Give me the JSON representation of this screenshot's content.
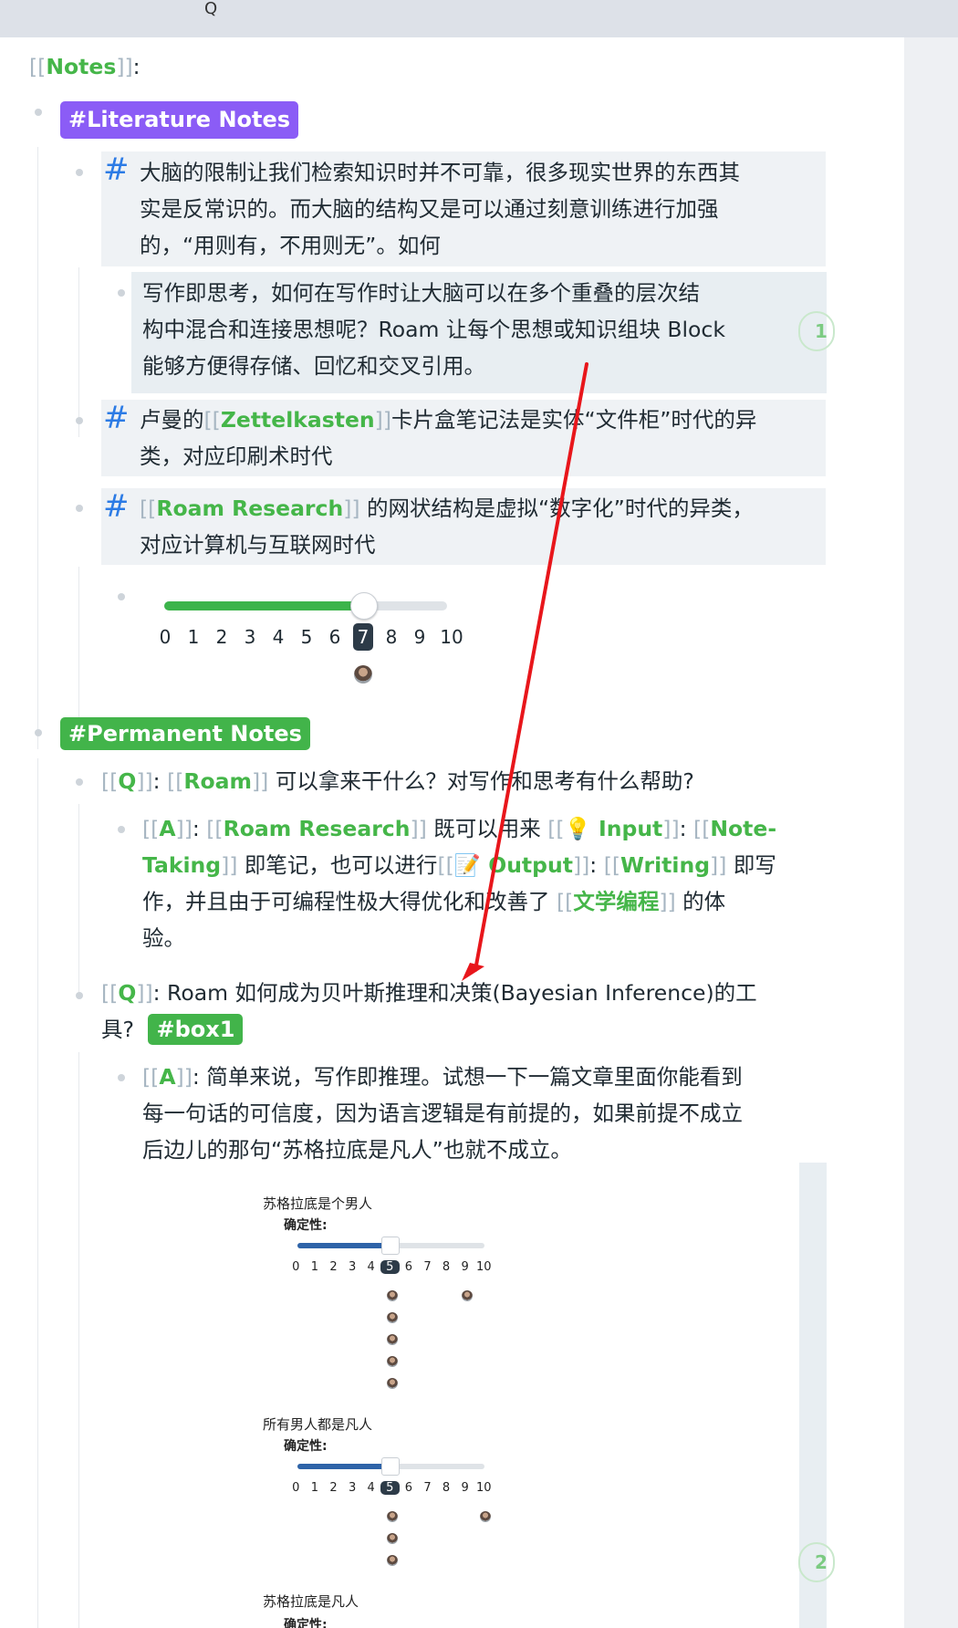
{
  "topbar": {
    "q_label": "Q"
  },
  "page": {
    "notes_bracket_open": "[[",
    "notes_title": "Notes",
    "notes_bracket_close": "]]",
    "notes_colon": ":"
  },
  "literature": {
    "tag": "#Literature Notes",
    "hash_glyph": "#",
    "block1": {
      "line1": "大脑的限制让我们检索知识时并不可靠，很多现实世界的东西其",
      "line2": "实是反常识的。而大脑的结构又是可以通过刻意训练进行加强",
      "line3": "的，“用则有，不用则无”。如何"
    },
    "child1": {
      "line1": "写作即思考，如何在写作时让大脑可以在多个重叠的层次结",
      "line2": "构中混合和连接思想呢？Roam 让每个思想或知识组块 Block",
      "line3": "能够方便得存储、回忆和交叉引用。",
      "badge": "1"
    },
    "block2": {
      "pre": "卢曼的",
      "link": "Zettelkasten",
      "post": "卡片盒笔记法是实体“文件柜”时代的异",
      "line2": "类，对应印刷术时代"
    },
    "block3": {
      "link": "Roam Research",
      "post": " 的网状结构是虚拟“数字化”时代的异类，",
      "line2": "对应计算机与互联网时代"
    },
    "slider": {
      "value": 7,
      "min": 0,
      "max": 10,
      "fill_color": "#3cb44b",
      "numbers": [
        "0",
        "1",
        "2",
        "3",
        "4",
        "5",
        "6",
        "7",
        "8",
        "9",
        "10"
      ]
    }
  },
  "permanent": {
    "tag": "#Permanent Notes",
    "q1": {
      "q": "Q",
      "roam": "Roam",
      "text": " 可以拿来干什么？对写作和思考有什么帮助?"
    },
    "a1": {
      "a": "A",
      "roam_research": "Roam Research",
      "t1": " 既可以用来 ",
      "input": "💡 Input",
      "note_a": "Note-",
      "note_b": "Taking",
      "t2": " 即笔记，也可以进行",
      "output": "📝 Output",
      "writing": "Writing",
      "t3": " 即写",
      "line3_pre": "作，并且由于可编程性极大得优化和改善了 ",
      "lit_prog": "文学编程",
      "line3_post": " 的体",
      "line4": "验。"
    },
    "q2": {
      "q": "Q",
      "text": ": Roam 如何成为贝叶斯推理和决策(Bayesian Inference)的工",
      "line2": "具?",
      "tag": "#box1"
    },
    "a2": {
      "a": "A",
      "line1": ": 简单来说，写作即推理。试想一下一篇文章里面你能看到",
      "line2": "每一句话的可信度，因为语言逻辑是有前提的，如果前提不成立",
      "line3": "后边儿的那句“苏格拉底是凡人”也就不成立。"
    },
    "embed": {
      "s1": {
        "title": "苏格拉底是个男人",
        "label": "确定性:",
        "value": 5
      },
      "s2": {
        "title": "所有男人都是凡人",
        "label": "确定性:",
        "value": 5
      },
      "s3": {
        "title": "苏格拉底是凡人",
        "label": "确定性:"
      },
      "numbers": [
        "0",
        "1",
        "2",
        "3",
        "4",
        "5",
        "6",
        "7",
        "8",
        "9",
        "10"
      ],
      "fill_color": "#2e63a8",
      "badge": "2"
    }
  }
}
